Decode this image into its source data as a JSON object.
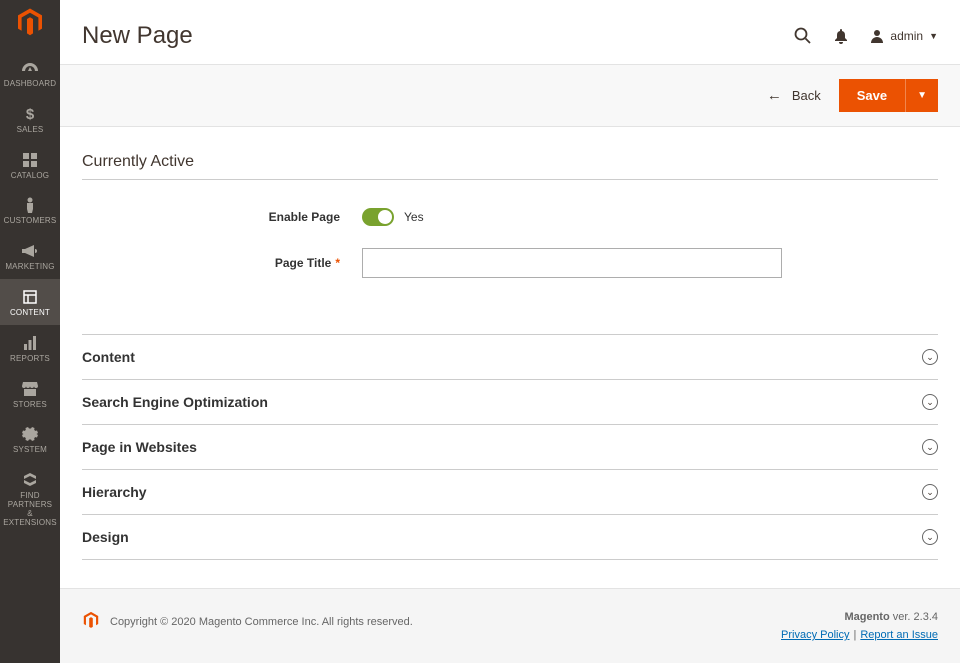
{
  "sidebar": {
    "items": [
      {
        "label": "DASHBOARD",
        "icon": "dashboard-icon"
      },
      {
        "label": "SALES",
        "icon": "dollar-icon"
      },
      {
        "label": "CATALOG",
        "icon": "grid-icon"
      },
      {
        "label": "CUSTOMERS",
        "icon": "person-icon"
      },
      {
        "label": "MARKETING",
        "icon": "megaphone-icon"
      },
      {
        "label": "CONTENT",
        "icon": "layout-icon",
        "active": true
      },
      {
        "label": "REPORTS",
        "icon": "bars-icon"
      },
      {
        "label": "STORES",
        "icon": "storefront-icon"
      },
      {
        "label": "SYSTEM",
        "icon": "gear-icon"
      },
      {
        "label": "FIND PARTNERS\n& EXTENSIONS",
        "icon": "extensions-icon"
      }
    ]
  },
  "header": {
    "title": "New Page",
    "user": "admin"
  },
  "actions": {
    "back": "Back",
    "save": "Save"
  },
  "form": {
    "section_title": "Currently Active",
    "enable_page": {
      "label": "Enable Page",
      "state": "Yes"
    },
    "page_title": {
      "label": "Page Title",
      "value": ""
    }
  },
  "collapsibles": [
    "Content",
    "Search Engine Optimization",
    "Page in Websites",
    "Hierarchy",
    "Design"
  ],
  "footer": {
    "copyright": "Copyright © 2020 Magento Commerce Inc. All rights reserved.",
    "product": "Magento",
    "version_prefix": " ver. ",
    "version": "2.3.4",
    "privacy": "Privacy Policy",
    "report": "Report an Issue"
  }
}
